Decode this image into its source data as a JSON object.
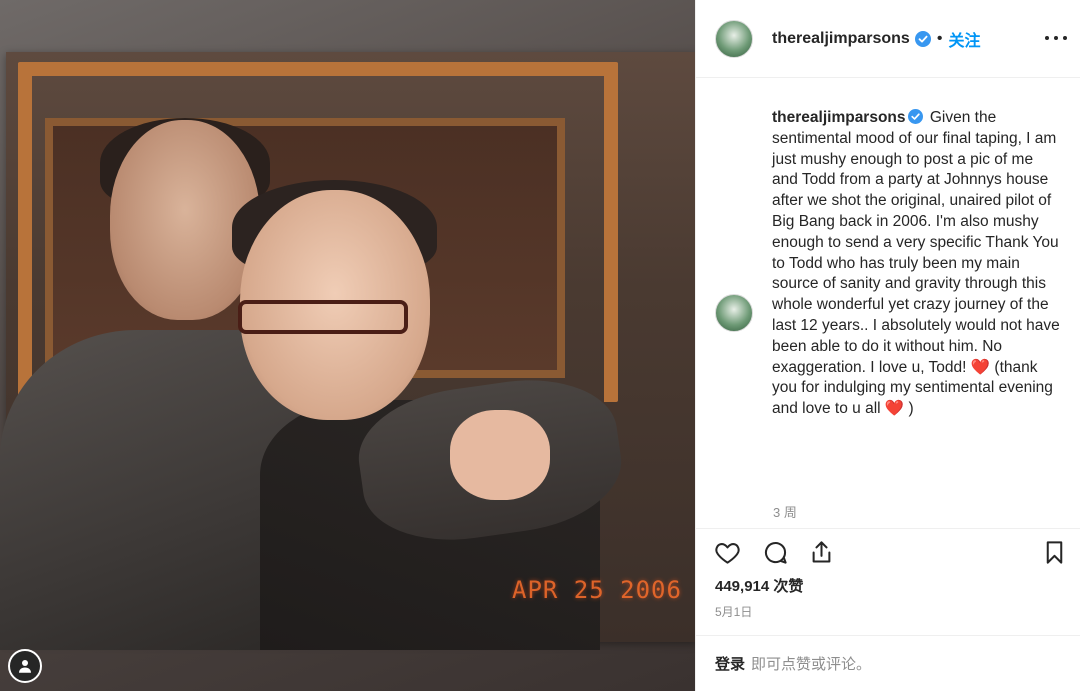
{
  "post": {
    "username": "therealjimparsons",
    "follow_label": "关注",
    "photo_date_stamp": "APR 25 2006",
    "caption_user": "therealjimparsons",
    "caption_body": "Given the sentimental mood of our final taping, I am just mushy enough to post a pic of me and Todd from a party at Johnnys house after we shot the original, unaired pilot of Big Bang back in 2006. I'm also mushy enough to send a very specific Thank You to Todd who has truly been my main source of sanity and gravity through this whole wonderful yet crazy journey of the last 12 years.. I absolutely would not have been able to do it without him. No exaggeration. I love u, Todd!",
    "caption_heart_1": "❤️",
    "caption_tail": "(thank you for indulging my sentimental evening and love to u all",
    "caption_heart_2": "❤️",
    "caption_close": ")",
    "time_ago": "3 周",
    "likes": "449,914 次赞",
    "date": "5月1日"
  },
  "footer": {
    "login_link": "登录",
    "login_rest": "即可点赞或评论。"
  },
  "icons": {
    "verified": "verified-badge-icon",
    "more": "more-options-icon",
    "like": "heart-icon",
    "comment": "comment-icon",
    "share": "share-icon",
    "save": "bookmark-icon",
    "photo_avatar": "profile-avatar-icon"
  },
  "colors": {
    "accent_blue": "#0095f6",
    "verified_blue": "#3897f0",
    "heart_red": "#ed4956",
    "date_stamp_orange": "#f26b2b",
    "muted_text": "#8e8e8e"
  }
}
